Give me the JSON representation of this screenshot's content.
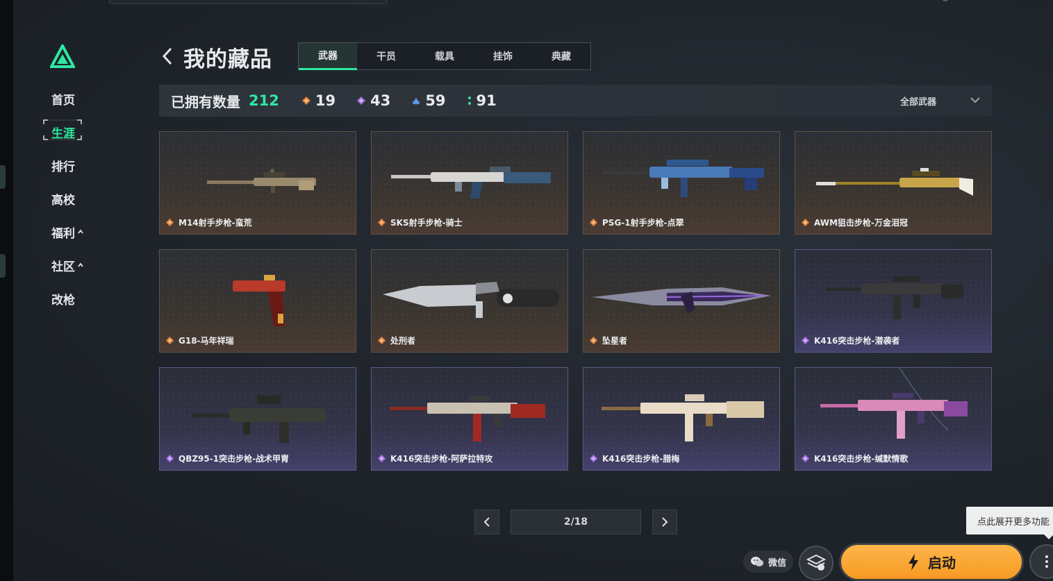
{
  "sidebar": {
    "items": [
      {
        "label": "首页",
        "caret": ""
      },
      {
        "label": "生涯",
        "caret": ""
      },
      {
        "label": "排行",
        "caret": ""
      },
      {
        "label": "高校",
        "caret": ""
      },
      {
        "label": "福利",
        "caret": "^"
      },
      {
        "label": "社区",
        "caret": "^"
      },
      {
        "label": "改枪",
        "caret": ""
      }
    ],
    "active_index": 1
  },
  "header": {
    "title": "我的藏品",
    "tabs": [
      "武器",
      "干员",
      "载具",
      "挂饰",
      "典藏"
    ],
    "active_tab": "武器"
  },
  "stats": {
    "owned_label": "已拥有数量",
    "owned_count": "212",
    "rarities": [
      {
        "count": "19",
        "icon": "gold-diamond-icon",
        "color": "#e0803a"
      },
      {
        "count": "43",
        "icon": "purple-diamond-icon",
        "color": "#a070e0"
      },
      {
        "count": "59",
        "icon": "blue-diamond-icon",
        "color": "#5a9ae8"
      },
      {
        "count": "91",
        "icon": "green-dot-icon",
        "color": "#2ee8a0"
      }
    ],
    "filter_label": "全部武器"
  },
  "cards": [
    {
      "name": "M14射手步枪-蛮荒",
      "rarity": "gold"
    },
    {
      "name": "SKS射手步枪-骑士",
      "rarity": "gold"
    },
    {
      "name": "PSG-1射手步枪-点翠",
      "rarity": "gold"
    },
    {
      "name": "AWM狙击步枪-万金泪冠",
      "rarity": "gold"
    },
    {
      "name": "G18-马年祥瑞",
      "rarity": "gold"
    },
    {
      "name": "处刑者",
      "rarity": "gold"
    },
    {
      "name": "坠星者",
      "rarity": "gold"
    },
    {
      "name": "K416突击步枪-潜袭者",
      "rarity": "purple"
    },
    {
      "name": "QBZ95-1突击步枪-战术甲胄",
      "rarity": "purple"
    },
    {
      "name": "K416突击步枪-阿萨拉特攻",
      "rarity": "purple"
    },
    {
      "name": "K416突击步枪-腊梅",
      "rarity": "purple"
    },
    {
      "name": "K416突击步枪-缄默情歌",
      "rarity": "purple"
    }
  ],
  "pagination": {
    "current": "2/18"
  },
  "footer": {
    "tooltip": "点此展开更多功能",
    "wechat_label": "微信",
    "launch_label": "启动"
  },
  "colors": {
    "accent": "#2ee8a0",
    "gold": "#e0803a",
    "purple": "#a070e0",
    "launch": "#f5a030"
  }
}
